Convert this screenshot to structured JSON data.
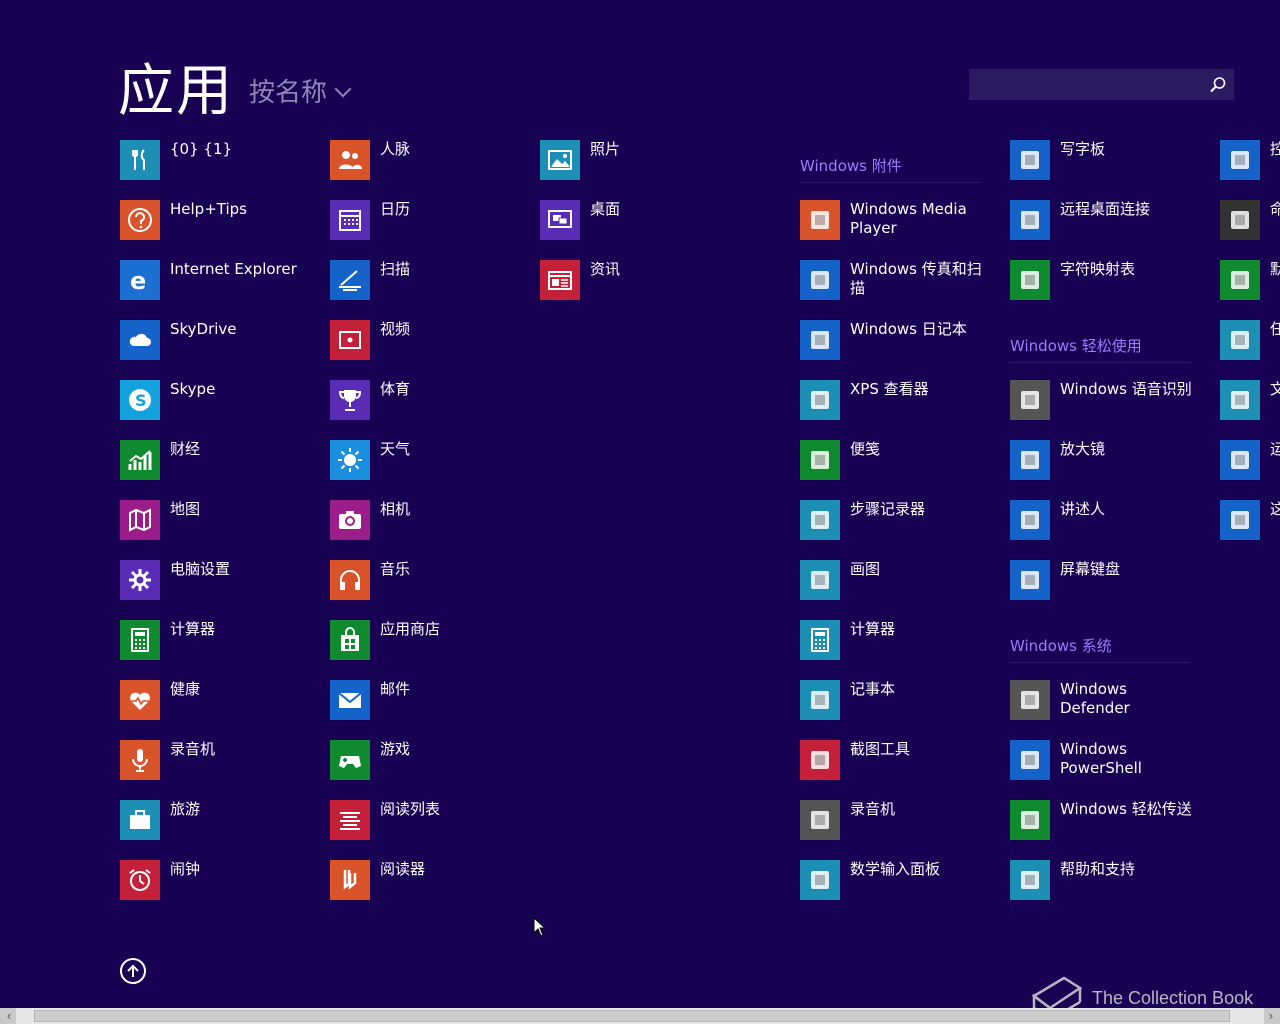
{
  "header": {
    "title": "应用",
    "sort_label": "按名称",
    "search": {
      "value": "",
      "placeholder": ""
    }
  },
  "columns": {
    "col1": [
      {
        "label": "{0} {1}",
        "color": "#1e8fb4",
        "icon": "fork-knife-icon"
      },
      {
        "label": "Help+Tips",
        "color": "#d9532b",
        "icon": "question-icon"
      },
      {
        "label": "Internet Explorer",
        "color": "#1a6fd1",
        "icon": "ie-icon"
      },
      {
        "label": "SkyDrive",
        "color": "#1563c8",
        "icon": "cloud-icon"
      },
      {
        "label": "Skype",
        "color": "#14a2de",
        "icon": "skype-icon"
      },
      {
        "label": "财经",
        "color": "#0f8a2e",
        "icon": "chart-icon"
      },
      {
        "label": "地图",
        "color": "#9a1d8a",
        "icon": "map-icon"
      },
      {
        "label": "电脑设置",
        "color": "#5a2bb5",
        "icon": "gear-icon"
      },
      {
        "label": "计算器",
        "color": "#0f8a2e",
        "icon": "calculator-icon"
      },
      {
        "label": "健康",
        "color": "#d9532b",
        "icon": "heart-icon"
      },
      {
        "label": "录音机",
        "color": "#d9532b",
        "icon": "microphone-icon"
      },
      {
        "label": "旅游",
        "color": "#1e8fb4",
        "icon": "suitcase-icon"
      },
      {
        "label": "闹钟",
        "color": "#c4203a",
        "icon": "alarm-icon"
      }
    ],
    "col2": [
      {
        "label": "人脉",
        "color": "#d9532b",
        "icon": "people-icon"
      },
      {
        "label": "日历",
        "color": "#5a2bb5",
        "icon": "calendar-icon"
      },
      {
        "label": "扫描",
        "color": "#1563c8",
        "icon": "scan-icon"
      },
      {
        "label": "视频",
        "color": "#c4203a",
        "icon": "video-icon"
      },
      {
        "label": "体育",
        "color": "#5a2bb5",
        "icon": "trophy-icon"
      },
      {
        "label": "天气",
        "color": "#1a8fe0",
        "icon": "sun-icon"
      },
      {
        "label": "相机",
        "color": "#9a1d8a",
        "icon": "camera-icon"
      },
      {
        "label": "音乐",
        "color": "#d9532b",
        "icon": "headphones-icon"
      },
      {
        "label": "应用商店",
        "color": "#0f8a2e",
        "icon": "store-icon"
      },
      {
        "label": "邮件",
        "color": "#1563c8",
        "icon": "mail-icon"
      },
      {
        "label": "游戏",
        "color": "#0f8a2e",
        "icon": "gamepad-icon"
      },
      {
        "label": "阅读列表",
        "color": "#c4203a",
        "icon": "reading-list-icon"
      },
      {
        "label": "阅读器",
        "color": "#d9532b",
        "icon": "reader-icon"
      }
    ],
    "col3": [
      {
        "label": "照片",
        "color": "#1e8fb4",
        "icon": "photo-icon"
      },
      {
        "label": "桌面",
        "color": "#5a2bb5",
        "icon": "desktop-icon"
      },
      {
        "label": "资讯",
        "color": "#c4203a",
        "icon": "news-icon"
      }
    ],
    "col4": {
      "group": "Windows 附件",
      "items": [
        {
          "label": "Windows Media Player",
          "color": "#d9532b",
          "icon": "media-player-icon"
        },
        {
          "label": "Windows 传真和扫描",
          "color": "#1563c8",
          "icon": "fax-icon"
        },
        {
          "label": "Windows 日记本",
          "color": "#1563c8",
          "icon": "journal-icon"
        },
        {
          "label": "XPS 查看器",
          "color": "#1e8fb4",
          "icon": "xps-icon"
        },
        {
          "label": "便笺",
          "color": "#0f8a2e",
          "icon": "sticky-notes-icon"
        },
        {
          "label": "步骤记录器",
          "color": "#1e8fb4",
          "icon": "steps-recorder-icon"
        },
        {
          "label": "画图",
          "color": "#1e8fb4",
          "icon": "paint-icon"
        },
        {
          "label": "计算器",
          "color": "#1e8fb4",
          "icon": "calculator-icon"
        },
        {
          "label": "记事本",
          "color": "#1e8fb4",
          "icon": "notepad-icon"
        },
        {
          "label": "截图工具",
          "color": "#c4203a",
          "icon": "snipping-tool-icon"
        },
        {
          "label": "录音机",
          "color": "#555555",
          "icon": "recorder-icon"
        },
        {
          "label": "数学输入面板",
          "color": "#1e8fb4",
          "icon": "math-input-icon"
        }
      ]
    },
    "col5": {
      "top_items": [
        {
          "label": "写字板",
          "color": "#1563c8",
          "icon": "wordpad-icon"
        },
        {
          "label": "远程桌面连接",
          "color": "#1563c8",
          "icon": "remote-desktop-icon"
        },
        {
          "label": "字符映射表",
          "color": "#0f8a2e",
          "icon": "charmap-icon"
        }
      ],
      "group_ease": "Windows 轻松使用",
      "ease_items": [
        {
          "label": "Windows 语音识别",
          "color": "#555555",
          "icon": "speech-icon"
        },
        {
          "label": "放大镜",
          "color": "#1563c8",
          "icon": "magnifier-icon"
        },
        {
          "label": "讲述人",
          "color": "#1563c8",
          "icon": "narrator-icon"
        },
        {
          "label": "屏幕键盘",
          "color": "#1563c8",
          "icon": "keyboard-icon"
        }
      ],
      "group_system": "Windows 系统",
      "system_items": [
        {
          "label": "Windows Defender",
          "color": "#555555",
          "icon": "defender-icon"
        },
        {
          "label": "Windows PowerShell",
          "color": "#1563c8",
          "icon": "powershell-icon"
        },
        {
          "label": "Windows 轻松传送",
          "color": "#0f8a2e",
          "icon": "easy-transfer-icon"
        },
        {
          "label": "帮助和支持",
          "color": "#1e8fb4",
          "icon": "help-support-icon"
        }
      ]
    },
    "col6": [
      {
        "label": "控",
        "color": "#1563c8",
        "icon": "control-panel-icon"
      },
      {
        "label": "命",
        "color": "#333333",
        "icon": "cmd-icon"
      },
      {
        "label": "默",
        "color": "#0f8a2e",
        "icon": "default-programs-icon"
      },
      {
        "label": "任",
        "color": "#1e8fb4",
        "icon": "task-manager-icon"
      },
      {
        "label": "文",
        "color": "#1e8fb4",
        "icon": "explorer-icon"
      },
      {
        "label": "运",
        "color": "#1563c8",
        "icon": "run-icon"
      },
      {
        "label": "这",
        "color": "#1563c8",
        "icon": "this-pc-icon"
      }
    ]
  },
  "footer": {
    "watermark": "The Collection Book"
  }
}
